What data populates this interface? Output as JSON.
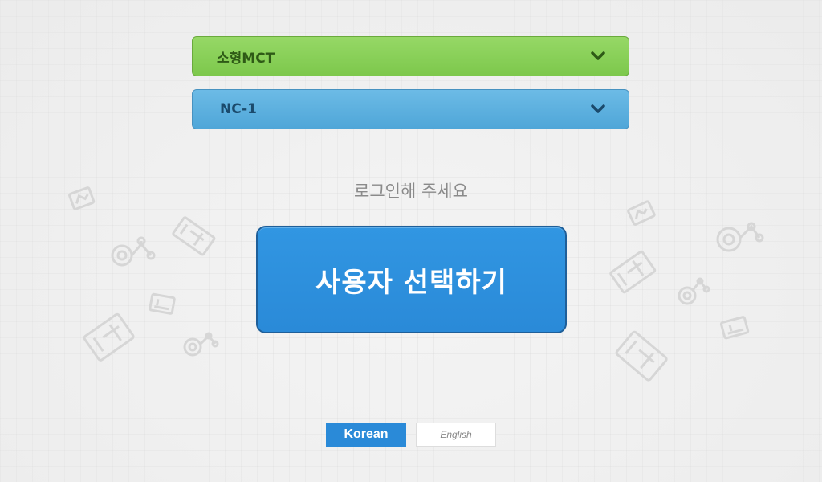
{
  "dropdowns": {
    "machine": {
      "value": "소형MCT"
    },
    "model": {
      "value": "NC-1"
    }
  },
  "prompt": "로그인해 주세요",
  "select_user_button": "사용자 선택하기",
  "language": {
    "korean": "Korean",
    "english": "English",
    "selected": "Korean"
  },
  "colors": {
    "machine_dropdown": "#88cf58",
    "model_dropdown": "#5cb0e0",
    "primary_button": "#2a8ad8",
    "prompt_text": "#8a8a8a",
    "decoration_icons": "#d8d8d8"
  },
  "icons": {
    "dropdown_chevron": "chevron-down-icon",
    "background": [
      "gear-network-icon",
      "cnc-machine-icon",
      "tablet-machine-icon"
    ]
  }
}
